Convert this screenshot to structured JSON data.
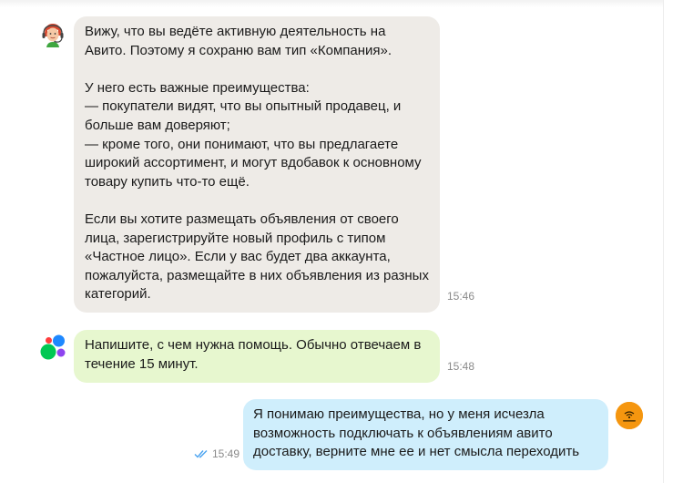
{
  "messages": [
    {
      "sender": "support",
      "text": "Вижу, что вы ведёте активную деятельность на Авито. Поэтому я сохраню вам тип «Компания».\n\nУ него есть важные преимущества:\n— покупатели видят, что вы опытный продавец, и больше вам доверяют;\n— кроме того, они понимают, что вы предлагаете широкий ассортимент, и могут вдобавок к основному товару купить что-то ещё.\n\nЕсли вы хотите размещать объявления от своего лица, зарегистрируйте новый профиль с типом «Частное лицо». Если у вас будет два аккаунта, пожалуйста, размещайте в них объявления из разных категорий.",
      "time": "15:46"
    },
    {
      "sender": "bot",
      "text": "Напишите, с чем нужна помощь. Обычно отвечаем в течение 15 минут.",
      "time": "15:48"
    },
    {
      "sender": "user",
      "text": "Я понимаю преимущества, но у меня исчезла возможность подключать к объявлениям авито доставку, верните мне ее и нет смысла переходить",
      "time": "15:49",
      "status": "read"
    }
  ],
  "icons": {
    "support_avatar": "support-agent-avatar",
    "bot_avatar": "avito-logo-avatar",
    "user_avatar": "user-avatar",
    "read_status": "double-check-icon"
  },
  "colors": {
    "incoming_bubble": "#eeebe7",
    "bot_bubble": "#e7f7cf",
    "outgoing_bubble": "#cfeefc",
    "check": "#4aa3f0",
    "user_avatar": "#f5960f"
  }
}
